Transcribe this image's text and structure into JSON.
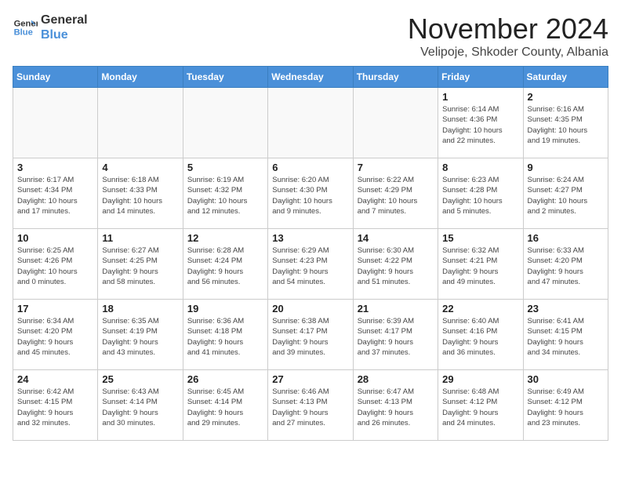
{
  "header": {
    "logo_line1": "General",
    "logo_line2": "Blue",
    "month": "November 2024",
    "location": "Velipoje, Shkoder County, Albania"
  },
  "days_of_week": [
    "Sunday",
    "Monday",
    "Tuesday",
    "Wednesday",
    "Thursday",
    "Friday",
    "Saturday"
  ],
  "weeks": [
    [
      {
        "day": "",
        "info": ""
      },
      {
        "day": "",
        "info": ""
      },
      {
        "day": "",
        "info": ""
      },
      {
        "day": "",
        "info": ""
      },
      {
        "day": "",
        "info": ""
      },
      {
        "day": "1",
        "info": "Sunrise: 6:14 AM\nSunset: 4:36 PM\nDaylight: 10 hours\nand 22 minutes."
      },
      {
        "day": "2",
        "info": "Sunrise: 6:16 AM\nSunset: 4:35 PM\nDaylight: 10 hours\nand 19 minutes."
      }
    ],
    [
      {
        "day": "3",
        "info": "Sunrise: 6:17 AM\nSunset: 4:34 PM\nDaylight: 10 hours\nand 17 minutes."
      },
      {
        "day": "4",
        "info": "Sunrise: 6:18 AM\nSunset: 4:33 PM\nDaylight: 10 hours\nand 14 minutes."
      },
      {
        "day": "5",
        "info": "Sunrise: 6:19 AM\nSunset: 4:32 PM\nDaylight: 10 hours\nand 12 minutes."
      },
      {
        "day": "6",
        "info": "Sunrise: 6:20 AM\nSunset: 4:30 PM\nDaylight: 10 hours\nand 9 minutes."
      },
      {
        "day": "7",
        "info": "Sunrise: 6:22 AM\nSunset: 4:29 PM\nDaylight: 10 hours\nand 7 minutes."
      },
      {
        "day": "8",
        "info": "Sunrise: 6:23 AM\nSunset: 4:28 PM\nDaylight: 10 hours\nand 5 minutes."
      },
      {
        "day": "9",
        "info": "Sunrise: 6:24 AM\nSunset: 4:27 PM\nDaylight: 10 hours\nand 2 minutes."
      }
    ],
    [
      {
        "day": "10",
        "info": "Sunrise: 6:25 AM\nSunset: 4:26 PM\nDaylight: 10 hours\nand 0 minutes."
      },
      {
        "day": "11",
        "info": "Sunrise: 6:27 AM\nSunset: 4:25 PM\nDaylight: 9 hours\nand 58 minutes."
      },
      {
        "day": "12",
        "info": "Sunrise: 6:28 AM\nSunset: 4:24 PM\nDaylight: 9 hours\nand 56 minutes."
      },
      {
        "day": "13",
        "info": "Sunrise: 6:29 AM\nSunset: 4:23 PM\nDaylight: 9 hours\nand 54 minutes."
      },
      {
        "day": "14",
        "info": "Sunrise: 6:30 AM\nSunset: 4:22 PM\nDaylight: 9 hours\nand 51 minutes."
      },
      {
        "day": "15",
        "info": "Sunrise: 6:32 AM\nSunset: 4:21 PM\nDaylight: 9 hours\nand 49 minutes."
      },
      {
        "day": "16",
        "info": "Sunrise: 6:33 AM\nSunset: 4:20 PM\nDaylight: 9 hours\nand 47 minutes."
      }
    ],
    [
      {
        "day": "17",
        "info": "Sunrise: 6:34 AM\nSunset: 4:20 PM\nDaylight: 9 hours\nand 45 minutes."
      },
      {
        "day": "18",
        "info": "Sunrise: 6:35 AM\nSunset: 4:19 PM\nDaylight: 9 hours\nand 43 minutes."
      },
      {
        "day": "19",
        "info": "Sunrise: 6:36 AM\nSunset: 4:18 PM\nDaylight: 9 hours\nand 41 minutes."
      },
      {
        "day": "20",
        "info": "Sunrise: 6:38 AM\nSunset: 4:17 PM\nDaylight: 9 hours\nand 39 minutes."
      },
      {
        "day": "21",
        "info": "Sunrise: 6:39 AM\nSunset: 4:17 PM\nDaylight: 9 hours\nand 37 minutes."
      },
      {
        "day": "22",
        "info": "Sunrise: 6:40 AM\nSunset: 4:16 PM\nDaylight: 9 hours\nand 36 minutes."
      },
      {
        "day": "23",
        "info": "Sunrise: 6:41 AM\nSunset: 4:15 PM\nDaylight: 9 hours\nand 34 minutes."
      }
    ],
    [
      {
        "day": "24",
        "info": "Sunrise: 6:42 AM\nSunset: 4:15 PM\nDaylight: 9 hours\nand 32 minutes."
      },
      {
        "day": "25",
        "info": "Sunrise: 6:43 AM\nSunset: 4:14 PM\nDaylight: 9 hours\nand 30 minutes."
      },
      {
        "day": "26",
        "info": "Sunrise: 6:45 AM\nSunset: 4:14 PM\nDaylight: 9 hours\nand 29 minutes."
      },
      {
        "day": "27",
        "info": "Sunrise: 6:46 AM\nSunset: 4:13 PM\nDaylight: 9 hours\nand 27 minutes."
      },
      {
        "day": "28",
        "info": "Sunrise: 6:47 AM\nSunset: 4:13 PM\nDaylight: 9 hours\nand 26 minutes."
      },
      {
        "day": "29",
        "info": "Sunrise: 6:48 AM\nSunset: 4:12 PM\nDaylight: 9 hours\nand 24 minutes."
      },
      {
        "day": "30",
        "info": "Sunrise: 6:49 AM\nSunset: 4:12 PM\nDaylight: 9 hours\nand 23 minutes."
      }
    ]
  ]
}
